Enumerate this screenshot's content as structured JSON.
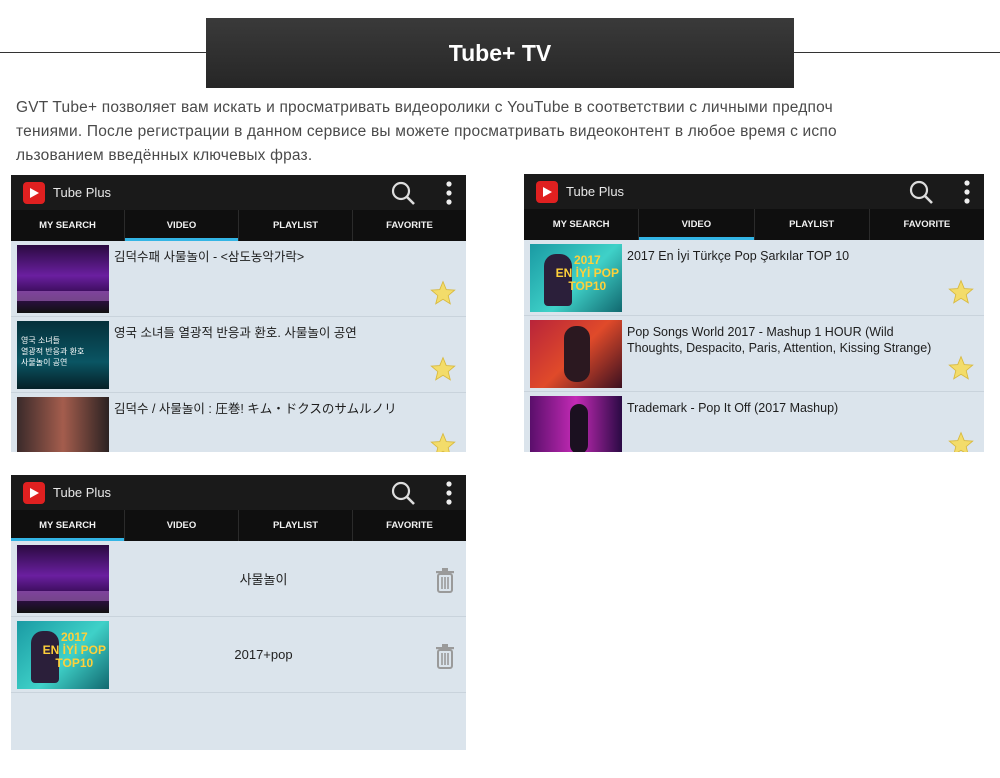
{
  "header": {
    "title": "Tube+ TV"
  },
  "description": "GVT Tube+ позволяет вам искать и просматривать видеоролики с YouTube в соответствии с личными предпочтениями. После регистрации в данном сервисе вы можете просматривать видеоконтент в любое время с использованием введённых ключевых фраз.",
  "description_lines": [
    "GVT Tube+ позволяет вам искать и просматривать видеоролики с YouTube в соответствии с личными предпоч",
    "тениями. После регистрации в данном сервисе вы можете просматривать видеоконтент в любое время с испо",
    "льзованием введённых ключевых фраз."
  ],
  "app": {
    "name": "Tube Plus",
    "accent": "#33b5e5",
    "icon_color": "#e02020"
  },
  "tabs": [
    "MY SEARCH",
    "VIDEO",
    "PLAYLIST",
    "FAVORITE"
  ],
  "screens": {
    "korean_video": {
      "active_tab": "VIDEO",
      "items": [
        {
          "title": "김덕수패 사물놀이 - <삼도농악가락>",
          "thumb": "stage",
          "action": "star-icon"
        },
        {
          "title": "영국 소녀들 열광적 반응과 환호. 사물놀이 공연",
          "thumb": "news",
          "thumb_text": "영국 소녀들\n열광적 반응과 환호\n사물놀이 공연",
          "action": "star-icon"
        },
        {
          "title": "김덕수 / 사물놀이 : 圧巻! キム・ドクスのサムルノリ",
          "thumb": "people",
          "action": "star-icon"
        }
      ]
    },
    "pop_video": {
      "active_tab": "VIDEO",
      "items": [
        {
          "title": "2017 En İyi Türkçe Pop Şarkılar TOP 10",
          "thumb": "pop2017",
          "thumb_text": "2017\nEN İYİ POP\nTOP10",
          "action": "star-icon"
        },
        {
          "title": "Pop Songs World 2017 -  Mashup 1 HOUR (Wild Thoughts, Despacito, Paris, Attention, Kissing Strange)",
          "thumb": "songs",
          "action": "star-icon"
        },
        {
          "title": "Trademark - Pop It Off (2017 Mashup)",
          "thumb": "trade",
          "action": "star-icon"
        }
      ]
    },
    "my_search": {
      "active_tab": "MY SEARCH",
      "items": [
        {
          "keyword": "사물놀이",
          "thumb": "stage",
          "action": "trash-icon"
        },
        {
          "keyword": "2017+pop",
          "thumb": "pop2017",
          "thumb_text": "2017\nEN İYİ POP\nTOP10",
          "action": "trash-icon"
        }
      ]
    }
  }
}
